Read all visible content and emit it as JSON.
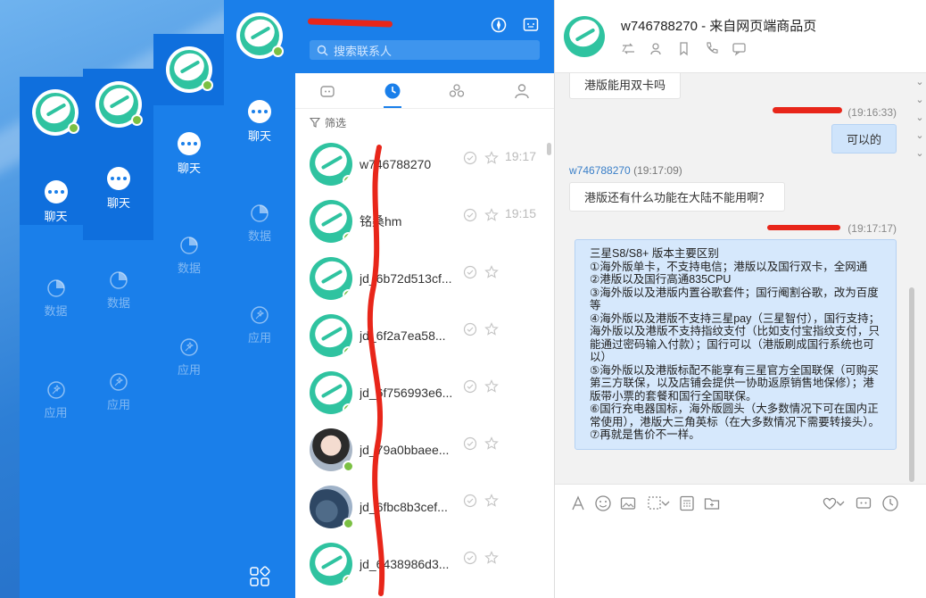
{
  "nav": {
    "chat": "聊天",
    "data": "数据",
    "app": "应用"
  },
  "list": {
    "search_placeholder": "搜索联系人",
    "filter_label": "筛选",
    "contacts": [
      {
        "name": "w746788270",
        "time": "19:17",
        "avatar": "logo"
      },
      {
        "name": "铭桑hm",
        "time": "19:15",
        "avatar": "logo"
      },
      {
        "name": "jd_6b72d513cf...",
        "time": "",
        "avatar": "logo"
      },
      {
        "name": "jd_6f2a7ea58...",
        "time": "",
        "avatar": "logo"
      },
      {
        "name": "jd_6f756993e6...",
        "time": "",
        "avatar": "logo"
      },
      {
        "name": "jd_79a0bbaee...",
        "time": "",
        "avatar": "photo1"
      },
      {
        "name": "jd_6fbc8b3cef...",
        "time": "",
        "avatar": "photo2"
      },
      {
        "name": "jd_6438986d3...",
        "time": "",
        "avatar": "logo"
      }
    ]
  },
  "chat": {
    "title": "w746788270 - 来自网页端商品页",
    "messages": {
      "m1": "港版能用双卡吗",
      "m2_time": "(19:16:33)",
      "m2": "可以的",
      "m3_sender": "w746788270",
      "m3_time": " (19:17:09)",
      "m3": "港版还有什么功能在大陆不能用啊？",
      "m4_time": "(19:17:17)",
      "m4_lines": [
        "三星S8/S8+ 版本主要区别",
        "①海外版单卡，不支持电信；港版以及国行双卡，全网通",
        "②港版以及国行高通835CPU",
        "③海外版以及港版内置谷歌套件；国行阉割谷歌，改为百度等",
        "④海外版以及港版不支持三星pay（三星智付），国行支持；海外版以及港版不支持指纹支付（比如支付宝指纹支付，只能通过密码输入付款）；国行可以（港版刷成国行系统也可以）",
        "⑤海外版以及港版标配不能享有三星官方全国联保（可购买第三方联保，以及店铺会提供一协助返原销售地保修）；港版带小票的套餐和国行全国联保。",
        "⑥国行充电器国标，海外版圆头（大多数情况下可在国内正常使用），港版大三角英标（在大多数情况下需要转接头）。",
        "⑦再就是售价不一样。"
      ]
    }
  },
  "colors": {
    "brand": "#1a7fea",
    "logo_green": "#2fc3a0",
    "online": "#7bc043",
    "annotation": "#e8261a"
  }
}
